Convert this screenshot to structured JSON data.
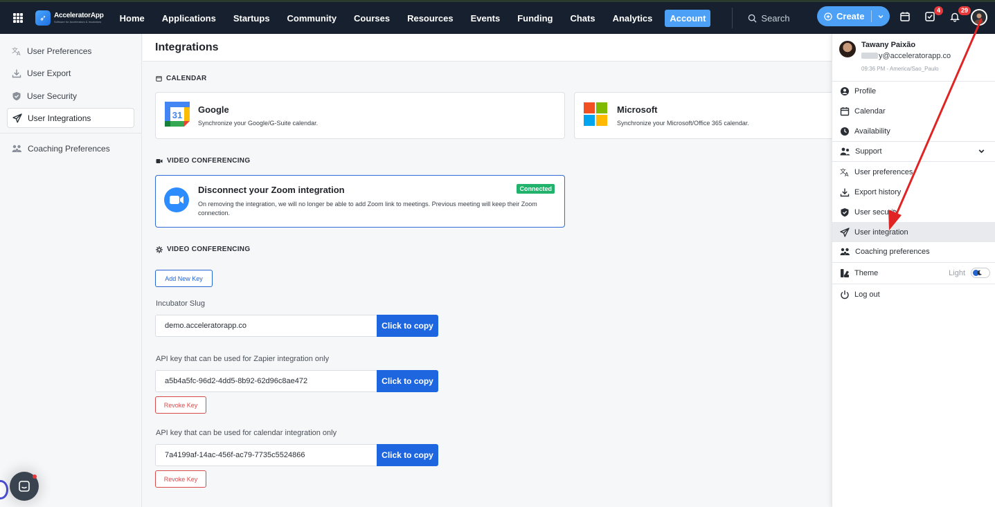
{
  "brand": {
    "name": "AcceleratorApp",
    "tagline": "Software for Accelerators & Incubators"
  },
  "nav": {
    "items": [
      {
        "label": "Home"
      },
      {
        "label": "Applications"
      },
      {
        "label": "Startups"
      },
      {
        "label": "Community"
      },
      {
        "label": "Courses"
      },
      {
        "label": "Resources"
      },
      {
        "label": "Events"
      },
      {
        "label": "Funding"
      },
      {
        "label": "Chats"
      },
      {
        "label": "Analytics"
      },
      {
        "label": "Account",
        "active": true
      }
    ],
    "search_placeholder": "Search",
    "create_label": "Create",
    "tasks_badge": "4",
    "notifications_badge": "29"
  },
  "sidebar": {
    "items": [
      {
        "label": "User Preferences",
        "icon": "translate-icon"
      },
      {
        "label": "User Export",
        "icon": "download-icon"
      },
      {
        "label": "User Security",
        "icon": "shield-icon"
      },
      {
        "label": "User Integrations",
        "icon": "send-icon",
        "active": true
      },
      {
        "label": "Coaching Preferences",
        "icon": "users-icon"
      }
    ]
  },
  "main": {
    "title": "Integrations",
    "calendar": {
      "section": "CALENDAR",
      "google": {
        "title": "Google",
        "desc": "Synchronize your Google/G-Suite calendar.",
        "icon_text": "31"
      },
      "microsoft": {
        "title": "Microsoft",
        "desc": "Synchronize your Microsoft/Office 365 calendar."
      }
    },
    "video": {
      "section": "VIDEO CONFERENCING",
      "zoom": {
        "title": "Disconnect your Zoom integration",
        "desc": "On removing the integration, we will no longer be able to add Zoom link to meetings. Previous meeting will keep their Zoom connection.",
        "status": "Connected"
      }
    },
    "keys": {
      "section": "VIDEO CONFERENCING",
      "add_label": "Add New Key",
      "slug_label": "Incubator Slug",
      "slug_value": "demo.acceleratorapp.co",
      "zapier_label": "API key that can be used for Zapier integration only",
      "zapier_value": "a5b4a5fc-96d2-4dd5-8b92-62d96c8ae472",
      "calendar_label": "API key that can be used for calendar integration only",
      "calendar_value": "7a4199af-14ac-456f-ac79-7735c5524866",
      "copy_label": "Click to copy",
      "revoke_label": "Revoke Key"
    }
  },
  "dropdown": {
    "user": {
      "name": "Tawany Paixão",
      "email_suffix": "y@acceleratorapp.co",
      "time": "09:36 PM - America/Sao_Paulo"
    },
    "items": [
      {
        "label": "Profile",
        "icon": "user-circle-icon"
      },
      {
        "label": "Calendar",
        "icon": "calendar-icon"
      },
      {
        "label": "Availability",
        "icon": "clock-icon"
      },
      {
        "label": "Support",
        "icon": "users-icon"
      },
      {
        "label": "User preferences",
        "icon": "translate-icon"
      },
      {
        "label": "Export history",
        "icon": "download-icon"
      },
      {
        "label": "User security",
        "icon": "shield-icon"
      },
      {
        "label": "User integration",
        "icon": "send-icon",
        "active": true
      },
      {
        "label": "Coaching preferences",
        "icon": "users-icon"
      },
      {
        "label": "Theme",
        "icon": "palette-icon"
      },
      {
        "label": "Log out",
        "icon": "power-icon"
      }
    ],
    "theme_value": "Light"
  },
  "colors": {
    "nav_bg": "#16202e",
    "accent": "#4ca0f6",
    "primary": "#1e66e0",
    "success": "#21b36b",
    "danger": "#d84a4a",
    "annotation_arrow": "#e02424"
  }
}
